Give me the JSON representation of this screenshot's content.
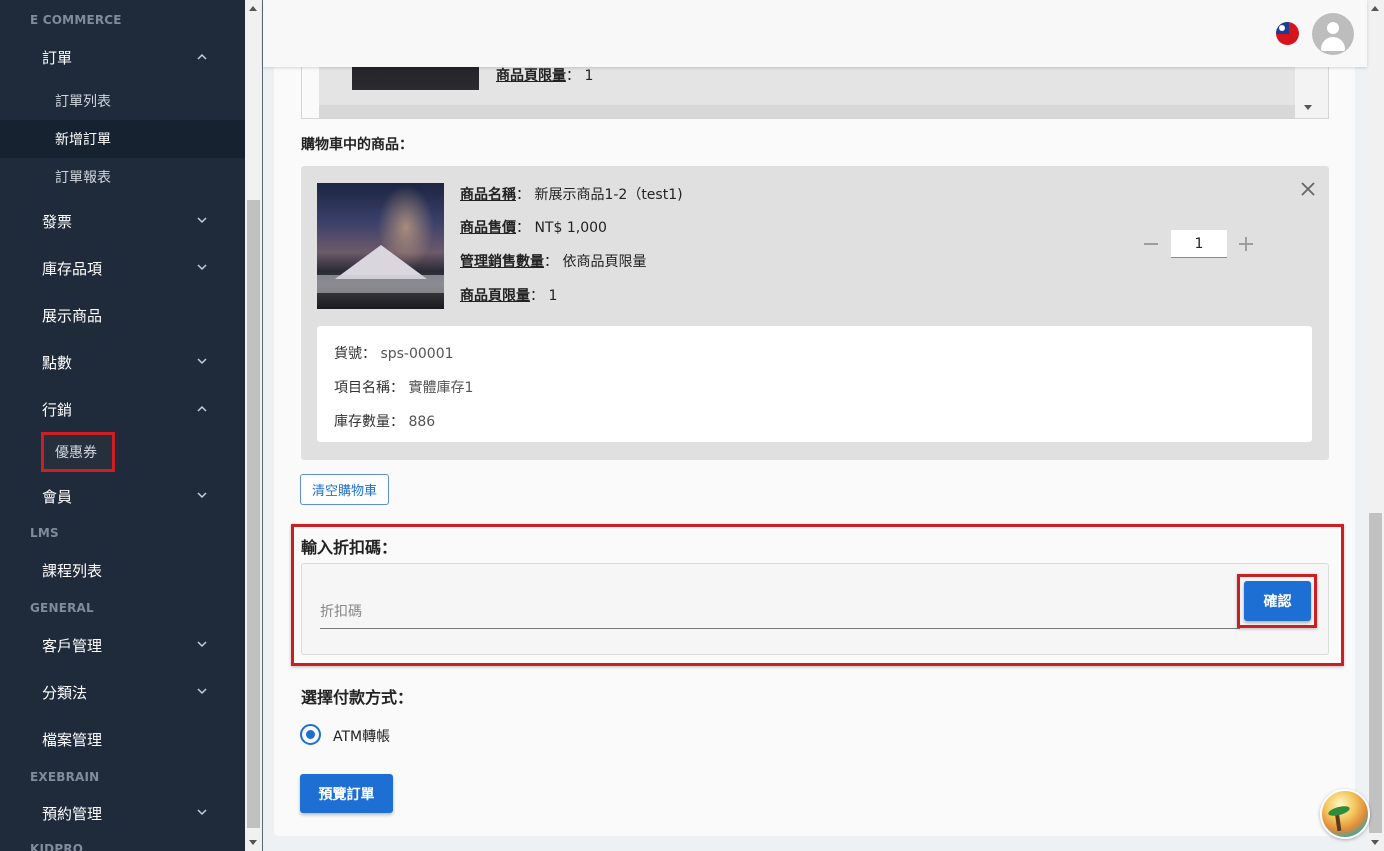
{
  "sidebar": {
    "sections": [
      {
        "title": "E COMMERCE"
      },
      {
        "title": "LMS"
      },
      {
        "title": "GENERAL"
      },
      {
        "title": "EXEBRAIN"
      },
      {
        "title": "KIDPRO"
      }
    ],
    "items": {
      "orders": "訂單",
      "order_list": "訂單列表",
      "new_order": "新增訂單",
      "order_report": "訂單報表",
      "invoice": "發票",
      "inventory": "庫存品項",
      "display_products": "展示商品",
      "points": "點數",
      "marketing": "行銷",
      "coupon": "優惠券",
      "members": "會員",
      "course_list": "課程列表",
      "customers": "客戶管理",
      "taxonomy": "分類法",
      "files": "檔案管理",
      "booking": "預約管理"
    }
  },
  "topbar": {
    "flag_icon": "taiwan-flag-icon",
    "avatar_icon": "user-avatar-icon"
  },
  "product_list": {
    "limit_label": "商品頁限量",
    "limit_value": "1"
  },
  "cart": {
    "title": "購物車中的商品：",
    "name_label": "商品名稱",
    "name_value": "新展示商品1-2（test1)",
    "price_label": "商品售價",
    "price_value": "NT$ 1,000",
    "manage_label": "管理銷售數量",
    "manage_value": "依商品頁限量",
    "limit_label": "商品頁限量",
    "limit_value": "1",
    "quantity": "1",
    "stock": {
      "sku_label": "貨號：",
      "sku_value": "sps-00001",
      "item_label": "項目名稱：",
      "item_value": "實體庫存1",
      "qty_label": "庫存數量：",
      "qty_value": "886"
    },
    "clear_label": "清空購物車"
  },
  "discount": {
    "title": "輸入折扣碼：",
    "placeholder": "折扣碼",
    "confirm_label": "確認"
  },
  "payment": {
    "title": "選擇付款方式：",
    "option": "ATM轉帳"
  },
  "preview_label": "預覽訂單",
  "colors": {
    "sidebar_bg": "#1f2a3a",
    "primary": "#1e6fd3",
    "highlight": "#cc1f24"
  }
}
